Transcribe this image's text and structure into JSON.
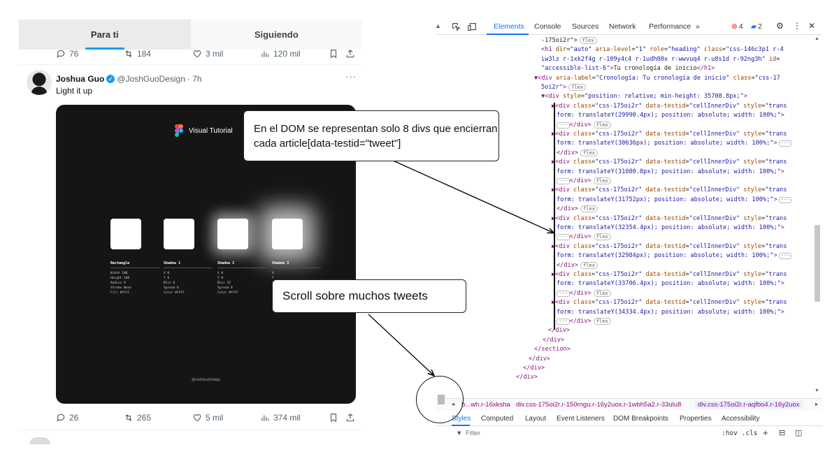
{
  "twitter": {
    "tabs": [
      "Para ti",
      "Siguiendo"
    ],
    "prev_actions": {
      "replies": "76",
      "retweets": "184",
      "likes": "3 mil",
      "views": "120 mil"
    },
    "tweet": {
      "name": "Joshua Guo",
      "handle": "@JoshGuoDesign",
      "time": "· 7h",
      "more": "···",
      "text": "Light it up",
      "media": {
        "title": "Visual Tutorial",
        "watermark": "@JoshGuoDesign",
        "specs": [
          {
            "heading": "Rectangle",
            "lines": [
              "Width     100",
              "Height    100",
              "Radius      8",
              "Stroke   None",
              "Fill    #FFFF"
            ]
          },
          {
            "heading": "Shadow 1",
            "lines": [
              "X           0",
              "Y           0",
              "Blur        8",
              "Spread      0",
              "Color  #FFFF"
            ]
          },
          {
            "heading": "Shadow 2",
            "lines": [
              "X           0",
              "Y           0",
              "Blur       32",
              "Spread      0",
              "Color  #FFFF"
            ]
          },
          {
            "heading": "Shadow 3",
            "lines": [
              "X",
              "Y",
              "Blur",
              "Spread",
              "Color"
            ]
          }
        ]
      },
      "actions": {
        "replies": "26",
        "retweets": "265",
        "likes": "5 mil",
        "views": "374 mil"
      }
    }
  },
  "annotations": {
    "dom_note": "En el DOM se representan solo 8 divs que encierran cada article[data-testid=\"tweet\"]",
    "scroll_note": "Scroll sobre muchos tweets"
  },
  "devtools": {
    "tabs": [
      "Elements",
      "Console",
      "Sources",
      "Network",
      "Performance",
      "»"
    ],
    "errors": "4",
    "messages": "2",
    "code_lines": [
      {
        "i": 0,
        "parts": [
          [
            "txt",
            "-175oi2r\">"
          ]
        ],
        "badge": "flex"
      },
      {
        "i": 1,
        "parts": [
          [
            "tag",
            "<h1 "
          ],
          [
            "attr",
            "dir"
          ],
          [
            "txt",
            "="
          ],
          [
            "val",
            "\"auto\""
          ],
          [
            "attr",
            " aria-level"
          ],
          [
            "txt",
            "="
          ],
          [
            "val",
            "\"1\""
          ],
          [
            "attr",
            " role"
          ],
          [
            "txt",
            "="
          ],
          [
            "val",
            "\"heading\""
          ],
          [
            "attr",
            " class"
          ],
          [
            "txt",
            "="
          ],
          [
            "val",
            "\"css-146c3p1 r-4"
          ]
        ]
      },
      {
        "i": 2,
        "parts": [
          [
            "val",
            "iw3lz r-1xk2f4g r-109y4c4 r-1udh08x r-wwvuq4 r-u8s1d r-92ng3h\""
          ],
          [
            "attr",
            " id"
          ],
          [
            "txt",
            "="
          ]
        ]
      },
      {
        "i": 3,
        "parts": [
          [
            "val",
            "\"accessible-list-6\""
          ],
          [
            "tag",
            ">"
          ],
          [
            "txt",
            "Tu cronología de inicio"
          ],
          [
            "tag",
            "</h1>"
          ]
        ]
      },
      {
        "i": 4,
        "parts": [
          [
            "tag",
            "▼<div "
          ],
          [
            "attr",
            "aria-label"
          ],
          [
            "txt",
            "="
          ],
          [
            "val",
            "\"Cronología: Tu cronología de inicio\""
          ],
          [
            "attr",
            " class"
          ],
          [
            "txt",
            "="
          ],
          [
            "val",
            "\"css-17"
          ]
        ]
      },
      {
        "i": 5,
        "parts": [
          [
            "val",
            "5oi2r\""
          ],
          [
            "tag",
            ">"
          ]
        ],
        "badge": "flex"
      },
      {
        "i": 6,
        "parts": [
          [
            "tag",
            "▼<div "
          ],
          [
            "attr",
            "style"
          ],
          [
            "txt",
            "="
          ],
          [
            "val",
            "\"position: relative; min-height: 35708.8px;\""
          ],
          [
            "tag",
            ">"
          ]
        ]
      },
      {
        "i": 7,
        "parts": [
          [
            "tag",
            "▶<div "
          ],
          [
            "attr",
            "class"
          ],
          [
            "txt",
            "="
          ],
          [
            "val",
            "\"css-175oi2r\""
          ],
          [
            "attr",
            " data-testid"
          ],
          [
            "txt",
            "="
          ],
          [
            "val",
            "\"cellInnerDiv\""
          ],
          [
            "attr",
            " style"
          ],
          [
            "txt",
            "="
          ],
          [
            "val",
            "\"trans"
          ]
        ]
      },
      {
        "i": 8,
        "parts": [
          [
            "val",
            "form: translateY(29990.4px); position: absolute; width: 100%;\""
          ],
          [
            "tag",
            ">"
          ]
        ]
      },
      {
        "i": 9,
        "parts": [
          [
            "tag",
            "</div>"
          ]
        ],
        "dots": true,
        "badge": "flex"
      },
      {
        "i": 10,
        "parts": [
          [
            "tag",
            "▶<div "
          ],
          [
            "attr",
            "class"
          ],
          [
            "txt",
            "="
          ],
          [
            "val",
            "\"css-175oi2r\""
          ],
          [
            "attr",
            " data-testid"
          ],
          [
            "txt",
            "="
          ],
          [
            "val",
            "\"cellInnerDiv\""
          ],
          [
            "attr",
            " style"
          ],
          [
            "txt",
            "="
          ],
          [
            "val",
            "\"trans"
          ]
        ]
      },
      {
        "i": 11,
        "parts": [
          [
            "val",
            "form: translateY(30636px); position: absolute; width: 100%;\""
          ],
          [
            "tag",
            ">"
          ]
        ],
        "dots_end": true
      },
      {
        "i": 12,
        "parts": [
          [
            "tag",
            "</div>"
          ]
        ],
        "badge": "flex"
      },
      {
        "i": 13,
        "parts": [
          [
            "tag",
            "▶<div "
          ],
          [
            "attr",
            "class"
          ],
          [
            "txt",
            "="
          ],
          [
            "val",
            "\"css-175oi2r\""
          ],
          [
            "attr",
            " data-testid"
          ],
          [
            "txt",
            "="
          ],
          [
            "val",
            "\"cellInnerDiv\""
          ],
          [
            "attr",
            " style"
          ],
          [
            "txt",
            "="
          ],
          [
            "val",
            "\"trans"
          ]
        ]
      },
      {
        "i": 14,
        "parts": [
          [
            "val",
            "form: translateY(31080.8px); position: absolute; width: 100%;\""
          ],
          [
            "tag",
            ">"
          ]
        ]
      },
      {
        "i": 15,
        "parts": [
          [
            "tag",
            "</div>"
          ]
        ],
        "dots": true,
        "badge": "flex"
      },
      {
        "i": 16,
        "parts": [
          [
            "tag",
            "▶<div "
          ],
          [
            "attr",
            "class"
          ],
          [
            "txt",
            "="
          ],
          [
            "val",
            "\"css-175oi2r\""
          ],
          [
            "attr",
            " data-testid"
          ],
          [
            "txt",
            "="
          ],
          [
            "val",
            "\"cellInnerDiv\""
          ],
          [
            "attr",
            " style"
          ],
          [
            "txt",
            "="
          ],
          [
            "val",
            "\"trans"
          ]
        ]
      },
      {
        "i": 17,
        "parts": [
          [
            "val",
            "form: translateY(31752px); position: absolute; width: 100%;\""
          ],
          [
            "tag",
            ">"
          ]
        ],
        "dots_end": true
      },
      {
        "i": 18,
        "parts": [
          [
            "tag",
            "</div>"
          ]
        ],
        "badge": "flex"
      },
      {
        "i": 19,
        "parts": [
          [
            "tag",
            "▶<div "
          ],
          [
            "attr",
            "class"
          ],
          [
            "txt",
            "="
          ],
          [
            "val",
            "\"css-175oi2r\""
          ],
          [
            "attr",
            " data-testid"
          ],
          [
            "txt",
            "="
          ],
          [
            "val",
            "\"cellInnerDiv\""
          ],
          [
            "attr",
            " style"
          ],
          [
            "txt",
            "="
          ],
          [
            "val",
            "\"trans"
          ]
        ]
      },
      {
        "i": 20,
        "parts": [
          [
            "val",
            "form: translateY(32354.4px); position: absolute; width: 100%;\""
          ],
          [
            "tag",
            ">"
          ]
        ]
      },
      {
        "i": 21,
        "parts": [
          [
            "tag",
            "</div>"
          ]
        ],
        "dots": true,
        "badge": "flex"
      },
      {
        "i": 22,
        "parts": [
          [
            "tag",
            "▶<div "
          ],
          [
            "attr",
            "class"
          ],
          [
            "txt",
            "="
          ],
          [
            "val",
            "\"css-175oi2r\""
          ],
          [
            "attr",
            " data-testid"
          ],
          [
            "txt",
            "="
          ],
          [
            "val",
            "\"cellInnerDiv\""
          ],
          [
            "attr",
            " style"
          ],
          [
            "txt",
            "="
          ],
          [
            "val",
            "\"trans"
          ]
        ]
      },
      {
        "i": 23,
        "parts": [
          [
            "val",
            "form: translateY(32984px); position: absolute; width: 100%;\""
          ],
          [
            "tag",
            ">"
          ]
        ],
        "dots_end": true
      },
      {
        "i": 24,
        "parts": [
          [
            "tag",
            "</div>"
          ]
        ],
        "badge": "flex"
      },
      {
        "i": 25,
        "parts": [
          [
            "tag",
            "▶<div "
          ],
          [
            "attr",
            "class"
          ],
          [
            "txt",
            "="
          ],
          [
            "val",
            "\"css-175oi2r\""
          ],
          [
            "attr",
            " data-testid"
          ],
          [
            "txt",
            "="
          ],
          [
            "val",
            "\"cellInnerDiv\""
          ],
          [
            "attr",
            " style"
          ],
          [
            "txt",
            "="
          ],
          [
            "val",
            "\"trans"
          ]
        ]
      },
      {
        "i": 26,
        "parts": [
          [
            "val",
            "form: translateY(33706.4px); position: absolute; width: 100%;\""
          ],
          [
            "tag",
            ">"
          ]
        ]
      },
      {
        "i": 27,
        "parts": [
          [
            "tag",
            "</div>"
          ]
        ],
        "dots": true,
        "badge": "flex"
      },
      {
        "i": 28,
        "parts": [
          [
            "tag",
            "▶<div "
          ],
          [
            "attr",
            "class"
          ],
          [
            "txt",
            "="
          ],
          [
            "val",
            "\"css-175oi2r\""
          ],
          [
            "attr",
            " data-testid"
          ],
          [
            "txt",
            "="
          ],
          [
            "val",
            "\"cellInnerDiv\""
          ],
          [
            "attr",
            " style"
          ],
          [
            "txt",
            "="
          ],
          [
            "val",
            "\"trans"
          ]
        ]
      },
      {
        "i": 29,
        "parts": [
          [
            "val",
            "form: translateY(34334.4px); position: absolute; width: 100%;\""
          ],
          [
            "tag",
            ">"
          ]
        ]
      },
      {
        "i": 30,
        "parts": [
          [
            "tag",
            "</div>"
          ]
        ],
        "dots": true,
        "badge": "flex"
      },
      {
        "i": 31,
        "parts": [
          [
            "tag",
            "</div>"
          ]
        ]
      },
      {
        "i": 32,
        "parts": [
          [
            "tag",
            "</div>"
          ]
        ]
      },
      {
        "i": 33,
        "parts": [
          [
            "tag",
            "</section>"
          ]
        ]
      },
      {
        "i": 34,
        "parts": [
          [
            "tag",
            "</div>"
          ]
        ]
      },
      {
        "i": 35,
        "parts": [
          [
            "tag",
            "</div>"
          ]
        ]
      },
      {
        "i": 36,
        "parts": [
          [
            "tag",
            "</div>"
          ]
        ]
      }
    ],
    "breadcrumbs": [
      "b...wh.r-16xksha",
      "div.css-175oi2r.r-150rngu.r-16y2uox.r-1wbh5a2.r-33ulu8",
      "div.css-175oi2r.r-aqfbo4.r-16y2uox"
    ],
    "subtabs": [
      "Styles",
      "Computed",
      "Layout",
      "Event Listeners",
      "DOM Breakpoints",
      "Properties",
      "Accessibility"
    ],
    "filter_placeholder": "Filter",
    "filter_tools": ":hov  .cls"
  }
}
